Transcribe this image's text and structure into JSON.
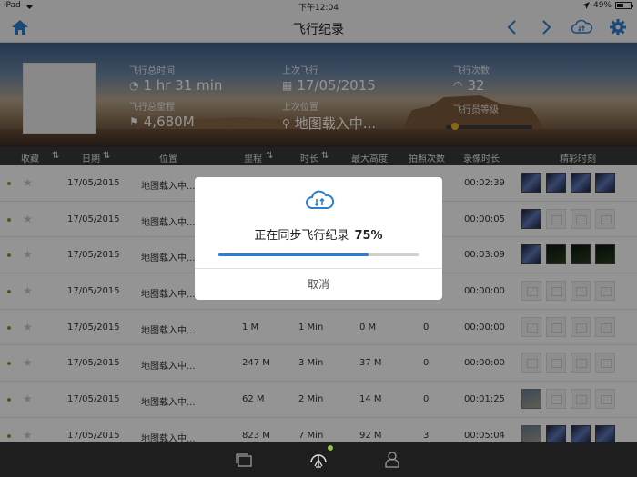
{
  "status_bar": {
    "device": "iPad",
    "time": "下午12:04",
    "battery": "49%"
  },
  "nav": {
    "title": "飞行纪录"
  },
  "hero": {
    "total_time_label": "飞行总时间",
    "total_time_value": "1 hr 31 min",
    "last_flight_label": "上次飞行",
    "last_flight_value": "17/05/2015",
    "flight_count_label": "飞行次数",
    "flight_count_value": "32",
    "total_distance_label": "飞行总里程",
    "total_distance_value": "4,680M",
    "last_location_label": "上次位置",
    "last_location_value": "地图载入中...",
    "level_label": "飞行员等级"
  },
  "columns": {
    "favorite": "收藏",
    "date": "日期",
    "location": "位置",
    "distance": "里程",
    "duration": "时长",
    "max_height": "最大高度",
    "photos": "拍照次数",
    "video": "录像时长",
    "highlights": "精彩时刻"
  },
  "rows": [
    {
      "date": "17/05/2015",
      "location": "地图载入中...",
      "distance": "",
      "duration": "",
      "height": "",
      "photos": "",
      "video": "00:02:39",
      "thumbs": [
        "img",
        "img",
        "img",
        "img"
      ]
    },
    {
      "date": "17/05/2015",
      "location": "地图载入中...",
      "distance": "",
      "duration": "",
      "height": "",
      "photos": "",
      "video": "00:00:05",
      "thumbs": [
        "img",
        "ph",
        "ph",
        "ph"
      ]
    },
    {
      "date": "17/05/2015",
      "location": "地图载入中...",
      "distance": "",
      "duration": "",
      "height": "",
      "photos": "",
      "video": "00:03:09",
      "thumbs": [
        "img",
        "img2",
        "img2",
        "img2"
      ]
    },
    {
      "date": "17/05/2015",
      "location": "地图载入中...",
      "distance": "",
      "duration": "",
      "height": "",
      "photos": "",
      "video": "00:00:00",
      "thumbs": [
        "ph",
        "ph",
        "ph",
        "ph"
      ]
    },
    {
      "date": "17/05/2015",
      "location": "地图载入中...",
      "distance": "1 M",
      "duration": "1 Min",
      "height": "0 M",
      "photos": "0",
      "video": "00:00:00",
      "thumbs": [
        "ph",
        "ph",
        "ph",
        "ph"
      ]
    },
    {
      "date": "17/05/2015",
      "location": "地图载入中...",
      "distance": "247 M",
      "duration": "3 Min",
      "height": "37 M",
      "photos": "0",
      "video": "00:00:00",
      "thumbs": [
        "ph",
        "ph",
        "ph",
        "ph"
      ]
    },
    {
      "date": "17/05/2015",
      "location": "地图载入中...",
      "distance": "62 M",
      "duration": "2 Min",
      "height": "14 M",
      "photos": "0",
      "video": "00:01:25",
      "thumbs": [
        "img3",
        "ph",
        "ph",
        "ph"
      ]
    },
    {
      "date": "17/05/2015",
      "location": "地图载入中...",
      "distance": "823 M",
      "duration": "7 Min",
      "height": "92 M",
      "photos": "3",
      "video": "00:05:04",
      "thumbs": [
        "img3",
        "img",
        "img",
        "img"
      ]
    }
  ],
  "dialog": {
    "message": "正在同步飞行纪录",
    "percent_text": "75%",
    "progress": 0.75,
    "cancel_label": "取消"
  },
  "colors": {
    "accent": "#2b7fd0",
    "tabbar": "#1e1e1e",
    "header_row": "#3a3a3a",
    "level_indicator": "#f0b428",
    "badge": "#8bc34a"
  }
}
